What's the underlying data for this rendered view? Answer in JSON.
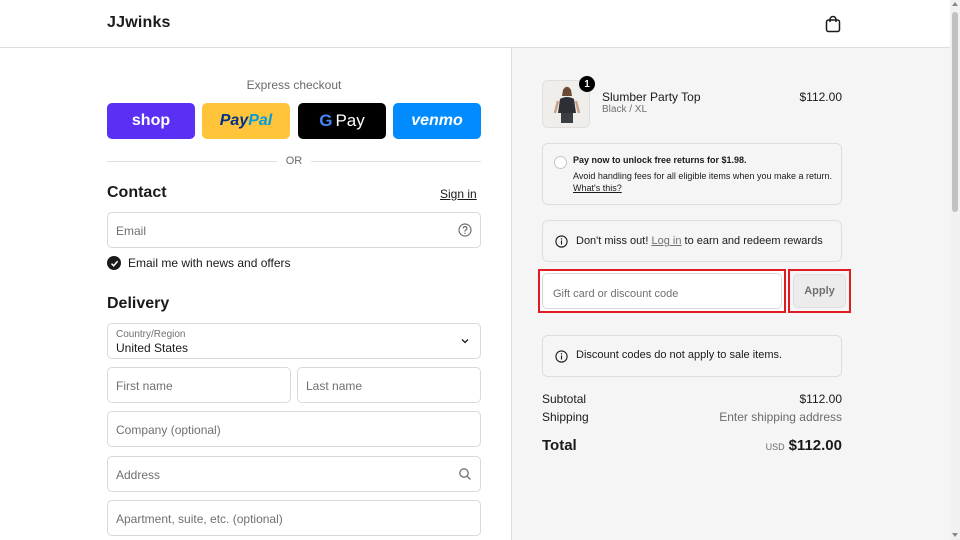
{
  "header": {
    "brand": "JJwinks"
  },
  "express": {
    "label": "Express checkout",
    "shop": "shop",
    "paypal_pay": "Pay",
    "paypal_pal": "Pal",
    "gpay_g": "G",
    "gpay_pay": "Pay",
    "venmo": "venmo",
    "or": "OR"
  },
  "contact": {
    "title": "Contact",
    "signin": "Sign in",
    "email_placeholder": "Email",
    "newsletter": "Email me with news and offers"
  },
  "delivery": {
    "title": "Delivery",
    "country_label": "Country/Region",
    "country_value": "United States",
    "first_name": "First name",
    "last_name": "Last name",
    "company": "Company (optional)",
    "address": "Address",
    "apartment": "Apartment, suite, etc. (optional)"
  },
  "summary": {
    "product": {
      "name": "Slumber Party Top",
      "variant": "Black / XL",
      "price": "$112.00",
      "quantity": "1"
    },
    "returns": {
      "title": "Pay now to unlock free returns for $1.98.",
      "body": "Avoid handling fees for all eligible items when you make a return.",
      "link": "What's this?"
    },
    "rewards": {
      "before": "Don't miss out!",
      "login": "Log in",
      "after": "to earn and redeem rewards"
    },
    "discount": {
      "placeholder": "Gift card or discount code",
      "apply": "Apply"
    },
    "codes_note": "Discount codes do not apply to sale items.",
    "subtotal_label": "Subtotal",
    "subtotal_value": "$112.00",
    "shipping_label": "Shipping",
    "shipping_value": "Enter shipping address",
    "total_label": "Total",
    "total_currency": "USD",
    "total_value": "$112.00"
  },
  "colors": {
    "shop": "#5a31f4",
    "paypal": "#ffc439",
    "gpay": "#000000",
    "venmo": "#008cff",
    "highlight": "#e11b22"
  }
}
